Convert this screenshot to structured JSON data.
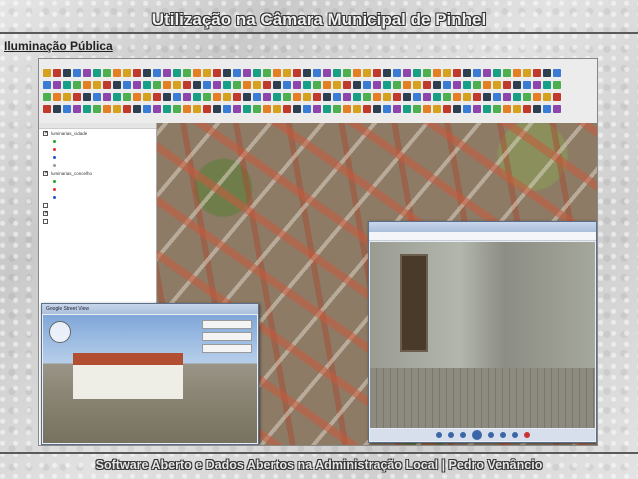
{
  "slide": {
    "title": "Utilização na Câmara Municipal de Pinhel",
    "subtitle": "Iluminação Pública",
    "footer": "Software Aberto e Dados Abertos na Administração Local   |   Pedro Venâncio"
  },
  "app": {
    "layers": [
      {
        "label": "luminarias_cidade",
        "checked": true,
        "sub": false
      },
      {
        "label": "",
        "checked": false,
        "sub": true,
        "color": "#22aa22"
      },
      {
        "label": "",
        "checked": false,
        "sub": true,
        "color": "#dd3333"
      },
      {
        "label": "",
        "checked": false,
        "sub": true,
        "color": "#2255cc"
      },
      {
        "label": "",
        "checked": false,
        "sub": true,
        "color": "#999999"
      },
      {
        "label": "luminarias_concelho",
        "checked": true,
        "sub": false
      },
      {
        "label": "",
        "checked": false,
        "sub": true,
        "color": "#22aa22"
      },
      {
        "label": "",
        "checked": false,
        "sub": true,
        "color": "#dd3333"
      },
      {
        "label": "",
        "checked": false,
        "sub": true,
        "color": "#2255cc"
      },
      {
        "label": "",
        "checked": false,
        "sub": false
      },
      {
        "label": "",
        "checked": true,
        "sub": false
      },
      {
        "label": "",
        "checked": false,
        "sub": false
      }
    ],
    "streetview": {
      "title": "Google Street View",
      "buttons": [
        "",
        "",
        ""
      ]
    },
    "photo_viewer": {
      "title": "",
      "menu": [
        "",
        "",
        "",
        "",
        "",
        ""
      ]
    }
  },
  "colors": {
    "title_text": "#f0f0f0",
    "rule": "#5a5a5a",
    "roof": "#b24f33"
  }
}
